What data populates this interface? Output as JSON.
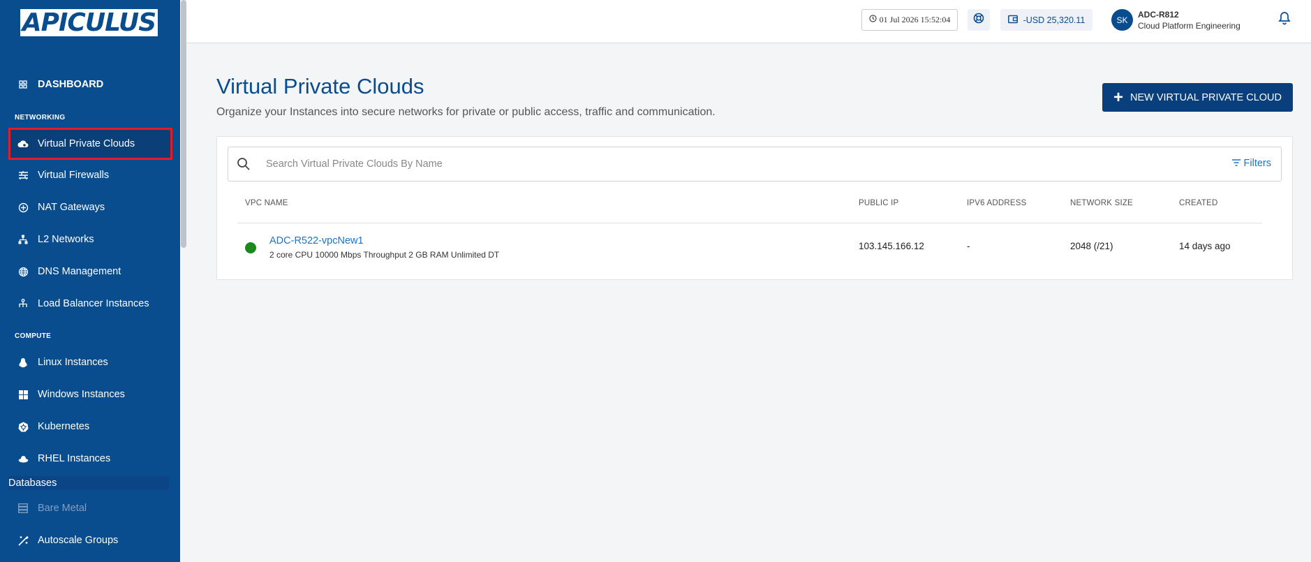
{
  "brand": {
    "logo_text": "APICULUS"
  },
  "sidebar": {
    "dashboard_label": "DASHBOARD",
    "networking_label": "NETWORKING",
    "compute_label": "COMPUTE",
    "databases_label": "Databases",
    "items": [
      {
        "label": "Virtual Private Clouds",
        "icon": "cloud-icon",
        "active": true
      },
      {
        "label": "Virtual Firewalls",
        "icon": "firewall-icon"
      },
      {
        "label": "NAT Gateways",
        "icon": "nat-gateway-icon"
      },
      {
        "label": "L2 Networks",
        "icon": "network-icon"
      },
      {
        "label": "DNS Management",
        "icon": "globe-icon"
      },
      {
        "label": "Load Balancer Instances",
        "icon": "load-balancer-icon"
      },
      {
        "label": "Linux Instances",
        "icon": "linux-icon"
      },
      {
        "label": "Windows Instances",
        "icon": "windows-icon"
      },
      {
        "label": "Kubernetes",
        "icon": "kubernetes-icon"
      },
      {
        "label": "RHEL Instances",
        "icon": "rhel-icon"
      },
      {
        "label": "Bare Metal",
        "icon": "server-icon",
        "disabled": true
      },
      {
        "label": "Autoscale Groups",
        "icon": "autoscale-icon"
      }
    ]
  },
  "topbar": {
    "datetime": "01 Jul 2026 15:52:04",
    "balance": "-USD 25,320.11",
    "user_initials": "SK",
    "user_name": "ADC-R812",
    "user_org": "Cloud Platform Engineering"
  },
  "main": {
    "title": "Virtual Private Clouds",
    "subtitle": "Organize your Instances into secure networks for private or public access, traffic and communication.",
    "new_button_label": "NEW VIRTUAL PRIVATE CLOUD",
    "search_placeholder": "Search Virtual Private Clouds By Name",
    "filters_label": "Filters",
    "columns": [
      "VPC NAME",
      "PUBLIC IP",
      "IPV6 ADDRESS",
      "NETWORK SIZE",
      "CREATED"
    ],
    "rows": [
      {
        "name": "ADC-R522-vpcNew1",
        "description": "2 core CPU 10000 Mbps Throughput 2 GB RAM Unlimited DT",
        "public_ip": "103.145.166.12",
        "ipv6": "-",
        "network_size": "2048 (/21)",
        "created": "14 days ago",
        "status_color": "#1b8a1b"
      }
    ]
  },
  "colors": {
    "primary": "#0a4d8f",
    "active_highlight": "#e21c2a",
    "link": "#1a73c8"
  }
}
